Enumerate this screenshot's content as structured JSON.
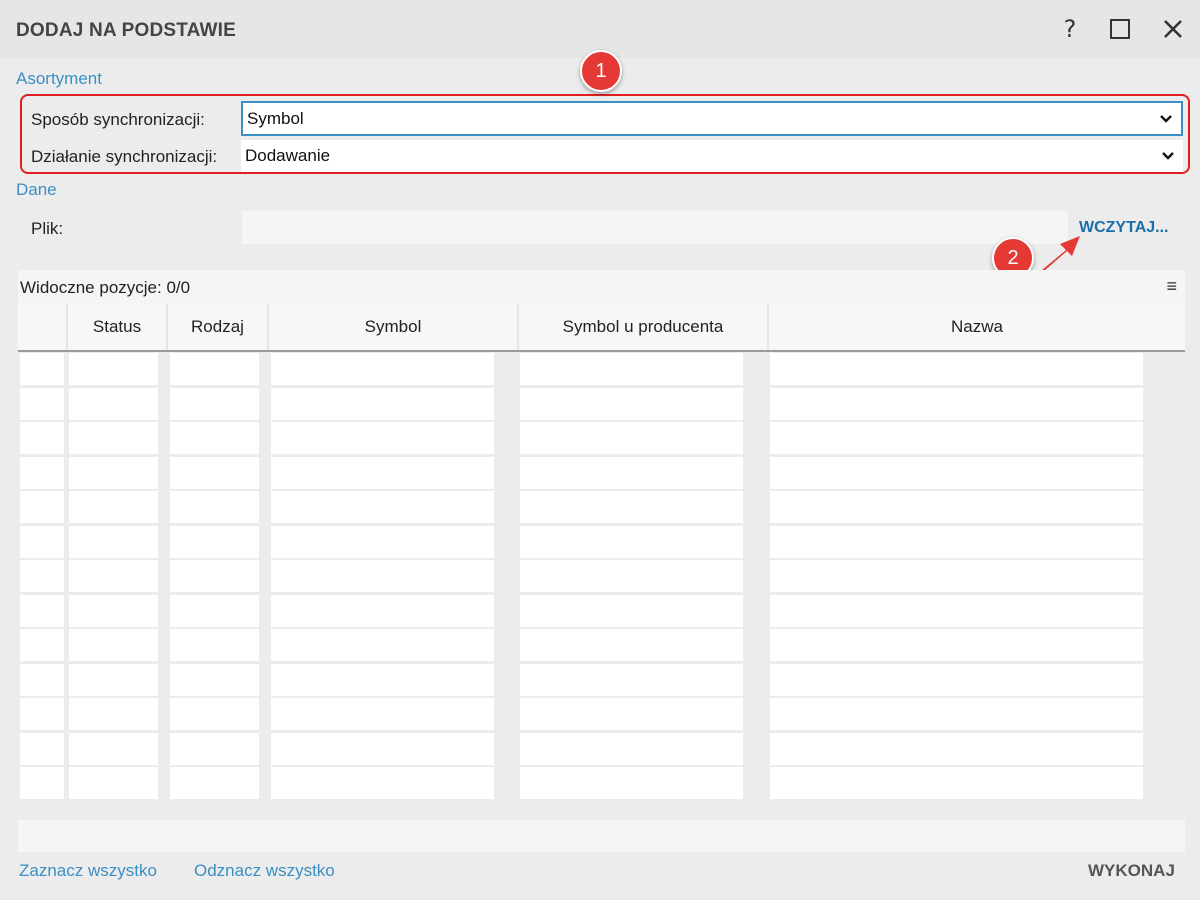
{
  "window": {
    "title": "DODAJ NA PODSTAWIE",
    "help_label": "?"
  },
  "assortment": {
    "section_label": "Asortyment",
    "sync_method_label": "Sposób synchronizacji:",
    "sync_method_value": "Symbol",
    "sync_action_label": "Działanie synchronizacji:",
    "sync_action_value": "Dodawanie"
  },
  "data_section": {
    "section_label": "Dane",
    "file_label": "Plik:",
    "file_value": "",
    "load_button": "WCZYTAJ..."
  },
  "grid": {
    "visible_count": "Widoczne pozycje: 0/0",
    "menu_glyph": "≡",
    "columns": [
      "",
      "Status",
      "Rodzaj",
      "Symbol",
      "Symbol u producenta",
      "Nazwa"
    ]
  },
  "annotations": {
    "badge_1": "1",
    "badge_2": "2"
  },
  "footer": {
    "select_all": "Zaznacz wszystko",
    "deselect_all": "Odznacz wszystko",
    "execute": "WYKONAJ"
  },
  "colors": {
    "accent_blue": "#3a8fc4",
    "link_blue": "#1a6fa8",
    "annotation_red": "#e53935"
  },
  "icons": {
    "close": "close-icon",
    "maximize": "maximize-icon",
    "dropdown": "chevron-down-icon",
    "columns_menu": "hamburger-menu-icon"
  }
}
